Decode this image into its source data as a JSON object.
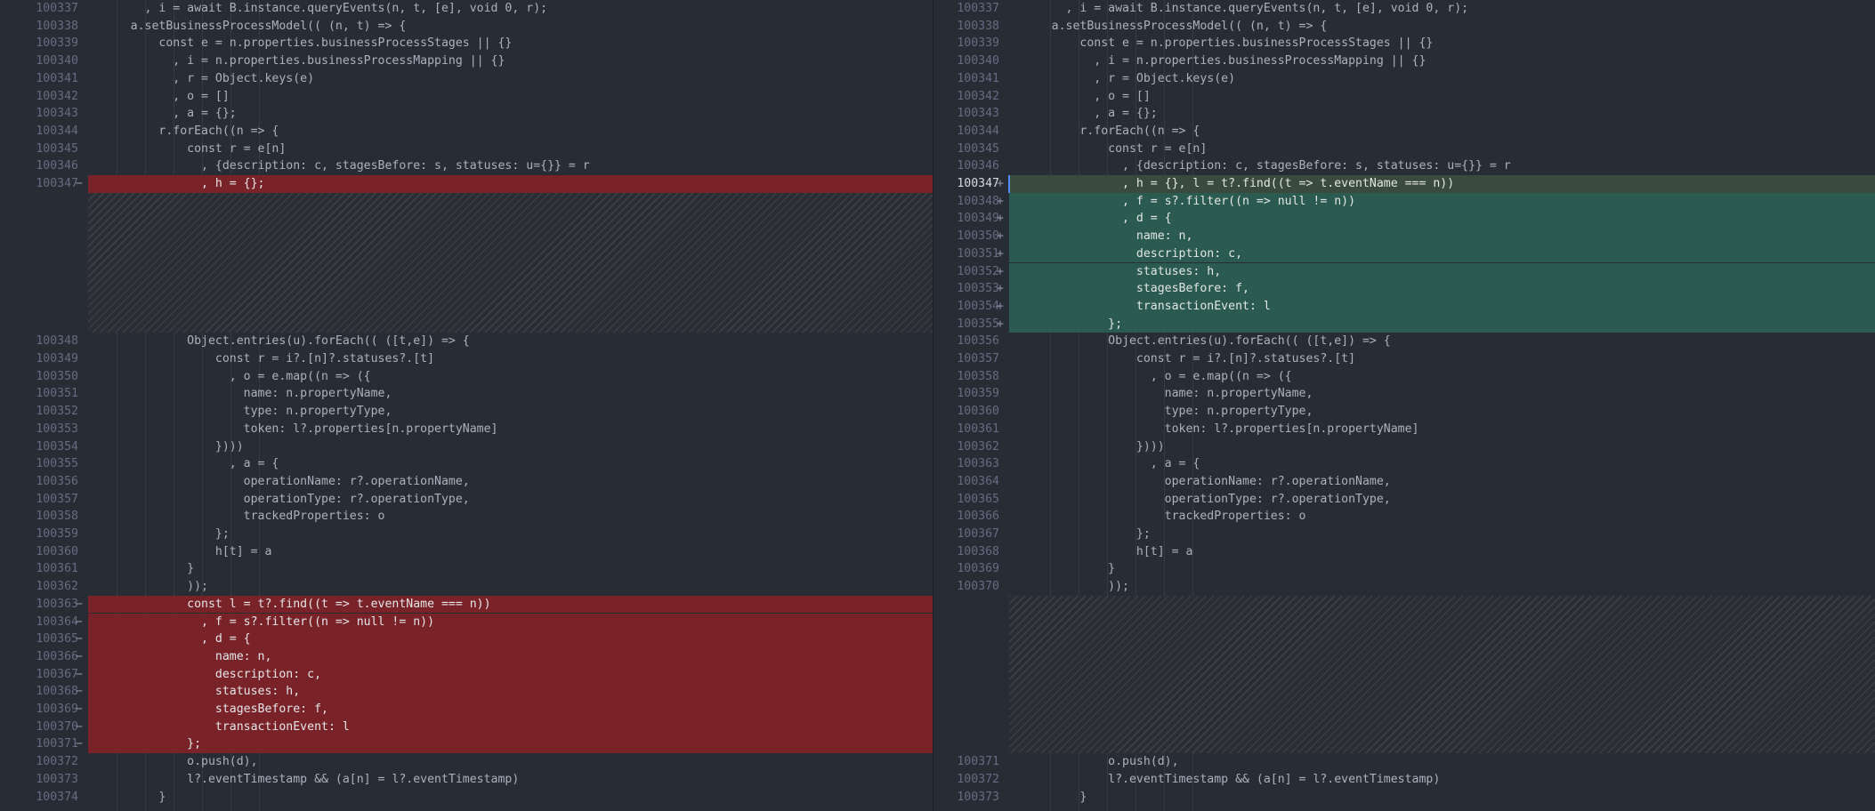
{
  "left": {
    "lines": [
      {
        "n": "100337",
        "t": "        , i = await B.instance.queryEvents(n, t, [e], void 0, r);",
        "k": "ctx"
      },
      {
        "n": "100338",
        "t": "      a.setBusinessProcessModel(( (n, t) => {",
        "k": "ctx"
      },
      {
        "n": "100339",
        "t": "          const e = n.properties.businessProcessStages || {}",
        "k": "ctx"
      },
      {
        "n": "100340",
        "t": "            , i = n.properties.businessProcessMapping || {}",
        "k": "ctx"
      },
      {
        "n": "100341",
        "t": "            , r = Object.keys(e)",
        "k": "ctx"
      },
      {
        "n": "100342",
        "t": "            , o = []",
        "k": "ctx"
      },
      {
        "n": "100343",
        "t": "            , a = {};",
        "k": "ctx"
      },
      {
        "n": "100344",
        "t": "          r.forEach((n => {",
        "k": "ctx"
      },
      {
        "n": "100345",
        "t": "              const r = e[n]",
        "k": "ctx"
      },
      {
        "n": "100346",
        "t": "                , {description: c, stagesBefore: s, statuses: u={}} = r",
        "k": "ctx"
      },
      {
        "n": "100347",
        "t": "                , h = {};",
        "k": "del"
      },
      {
        "k": "filler",
        "rows": 8
      },
      {
        "n": "100348",
        "t": "              Object.entries(u).forEach(( ([t,e]) => {",
        "k": "ctx"
      },
      {
        "n": "100349",
        "t": "                  const r = i?.[n]?.statuses?.[t]",
        "k": "ctx"
      },
      {
        "n": "100350",
        "t": "                    , o = e.map((n => ({",
        "k": "ctx"
      },
      {
        "n": "100351",
        "t": "                      name: n.propertyName,",
        "k": "ctx"
      },
      {
        "n": "100352",
        "t": "                      type: n.propertyType,",
        "k": "ctx"
      },
      {
        "n": "100353",
        "t": "                      token: l?.properties[n.propertyName]",
        "k": "ctx"
      },
      {
        "n": "100354",
        "t": "                  })))",
        "k": "ctx"
      },
      {
        "n": "100355",
        "t": "                    , a = {",
        "k": "ctx"
      },
      {
        "n": "100356",
        "t": "                      operationName: r?.operationName,",
        "k": "ctx"
      },
      {
        "n": "100357",
        "t": "                      operationType: r?.operationType,",
        "k": "ctx"
      },
      {
        "n": "100358",
        "t": "                      trackedProperties: o",
        "k": "ctx"
      },
      {
        "n": "100359",
        "t": "                  };",
        "k": "ctx"
      },
      {
        "n": "100360",
        "t": "                  h[t] = a",
        "k": "ctx"
      },
      {
        "n": "100361",
        "t": "              }",
        "k": "ctx"
      },
      {
        "n": "100362",
        "t": "              ));",
        "k": "ctx"
      },
      {
        "n": "100363",
        "t": "              const l = t?.find((t => t.eventName === n))",
        "k": "del"
      },
      {
        "n": "100364",
        "t": "                , f = s?.filter((n => null != n))",
        "k": "del"
      },
      {
        "n": "100365",
        "t": "                , d = {",
        "k": "del"
      },
      {
        "n": "100366",
        "t": "                  name: n,",
        "k": "del"
      },
      {
        "n": "100367",
        "t": "                  description: c,",
        "k": "del"
      },
      {
        "n": "100368",
        "t": "                  statuses: h,",
        "k": "del"
      },
      {
        "n": "100369",
        "t": "                  stagesBefore: f,",
        "k": "del"
      },
      {
        "n": "100370",
        "t": "                  transactionEvent: l",
        "k": "del"
      },
      {
        "n": "100371",
        "t": "              };",
        "k": "del"
      },
      {
        "n": "100372",
        "t": "              o.push(d),",
        "k": "ctx"
      },
      {
        "n": "100373",
        "t": "              l?.eventTimestamp && (a[n] = l?.eventTimestamp)",
        "k": "ctx"
      },
      {
        "n": "100374",
        "t": "          }",
        "k": "ctx"
      }
    ]
  },
  "right": {
    "lines": [
      {
        "n": "100337",
        "t": "        , i = await B.instance.queryEvents(n, t, [e], void 0, r);",
        "k": "ctx"
      },
      {
        "n": "100338",
        "t": "      a.setBusinessProcessModel(( (n, t) => {",
        "k": "ctx"
      },
      {
        "n": "100339",
        "t": "          const e = n.properties.businessProcessStages || {}",
        "k": "ctx"
      },
      {
        "n": "100340",
        "t": "            , i = n.properties.businessProcessMapping || {}",
        "k": "ctx"
      },
      {
        "n": "100341",
        "t": "            , r = Object.keys(e)",
        "k": "ctx"
      },
      {
        "n": "100342",
        "t": "            , o = []",
        "k": "ctx"
      },
      {
        "n": "100343",
        "t": "            , a = {};",
        "k": "ctx"
      },
      {
        "n": "100344",
        "t": "          r.forEach((n => {",
        "k": "ctx",
        "bracket": true
      },
      {
        "n": "100345",
        "t": "              const r = e[n]",
        "k": "ctx"
      },
      {
        "n": "100346",
        "t": "                , {description: c, stagesBefore: s, statuses: u={}} = r",
        "k": "ctx"
      },
      {
        "n": "100347",
        "t": "                , h = {}, l = t?.find((t => t.eventName === n))",
        "k": "add",
        "cur": true
      },
      {
        "n": "100348",
        "t": "                , f = s?.filter((n => null != n))",
        "k": "add"
      },
      {
        "n": "100349",
        "t": "                , d = {",
        "k": "add"
      },
      {
        "n": "100350",
        "t": "                  name: n,",
        "k": "add"
      },
      {
        "n": "100351",
        "t": "                  description: c,",
        "k": "add"
      },
      {
        "n": "100352",
        "t": "                  statuses: h,",
        "k": "add"
      },
      {
        "n": "100353",
        "t": "                  stagesBefore: f,",
        "k": "add"
      },
      {
        "n": "100354",
        "t": "                  transactionEvent: l",
        "k": "add"
      },
      {
        "n": "100355",
        "t": "              };",
        "k": "add"
      },
      {
        "n": "100356",
        "t": "              Object.entries(u).forEach(( ([t,e]) => {",
        "k": "ctx"
      },
      {
        "n": "100357",
        "t": "                  const r = i?.[n]?.statuses?.[t]",
        "k": "ctx"
      },
      {
        "n": "100358",
        "t": "                    , o = e.map((n => ({",
        "k": "ctx"
      },
      {
        "n": "100359",
        "t": "                      name: n.propertyName,",
        "k": "ctx"
      },
      {
        "n": "100360",
        "t": "                      type: n.propertyType,",
        "k": "ctx"
      },
      {
        "n": "100361",
        "t": "                      token: l?.properties[n.propertyName]",
        "k": "ctx"
      },
      {
        "n": "100362",
        "t": "                  })))",
        "k": "ctx"
      },
      {
        "n": "100363",
        "t": "                    , a = {",
        "k": "ctx"
      },
      {
        "n": "100364",
        "t": "                      operationName: r?.operationName,",
        "k": "ctx"
      },
      {
        "n": "100365",
        "t": "                      operationType: r?.operationType,",
        "k": "ctx"
      },
      {
        "n": "100366",
        "t": "                      trackedProperties: o",
        "k": "ctx"
      },
      {
        "n": "100367",
        "t": "                  };",
        "k": "ctx"
      },
      {
        "n": "100368",
        "t": "                  h[t] = a",
        "k": "ctx"
      },
      {
        "n": "100369",
        "t": "              }",
        "k": "ctx"
      },
      {
        "n": "100370",
        "t": "              ));",
        "k": "ctx"
      },
      {
        "k": "filler",
        "rows": 9
      },
      {
        "n": "100371",
        "t": "              o.push(d),",
        "k": "ctx"
      },
      {
        "n": "100372",
        "t": "              l?.eventTimestamp && (a[n] = l?.eventTimestamp)",
        "k": "ctx"
      },
      {
        "n": "100373",
        "t": "          }",
        "k": "ctx",
        "bracket": true
      }
    ]
  },
  "markers": {
    "del": "−",
    "add": "+"
  },
  "colors": {
    "background": "#282c34",
    "deleted": "#792227",
    "added": "#2b5a50",
    "line_number": "#636d83",
    "text": "#abb2bf"
  }
}
